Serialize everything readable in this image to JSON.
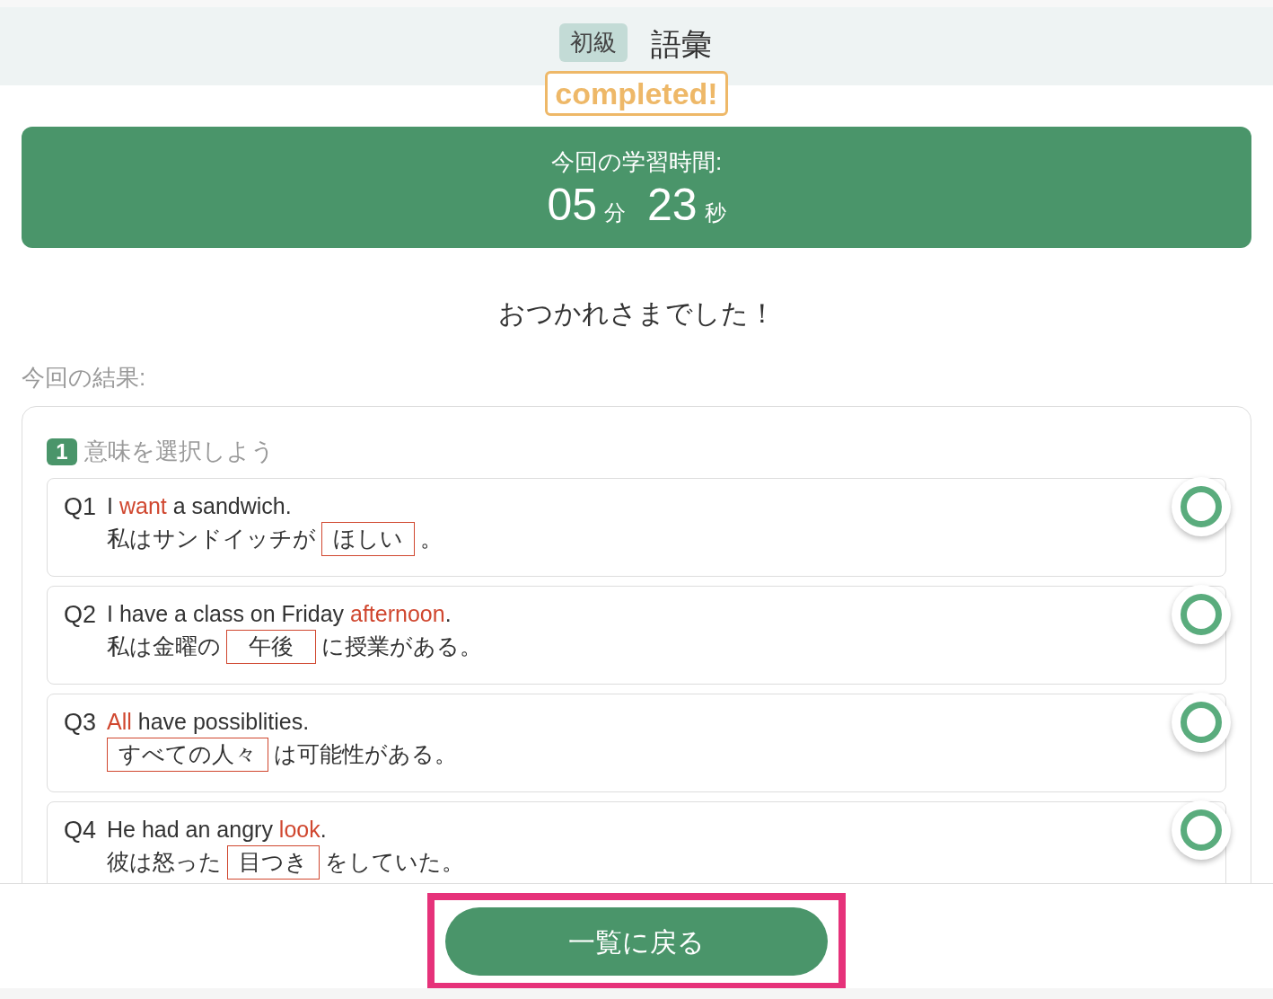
{
  "header": {
    "level_badge": "初級",
    "title": "語彙",
    "status": "completed!"
  },
  "timer": {
    "label": "今回の学習時間:",
    "minutes": "05",
    "minutes_unit": "分",
    "seconds": "23",
    "seconds_unit": "秒"
  },
  "message": "おつかれさまでした！",
  "results_label": "今回の結果:",
  "section": {
    "number": "1",
    "title": "意味を選択しよう"
  },
  "questions": [
    {
      "label": "Q1",
      "english": {
        "before": "I ",
        "keyword": "want",
        "after": " a sandwich."
      },
      "japanese": {
        "before": "私はサンドイッチが",
        "answer": "ほしい",
        "after": "。"
      },
      "correct": true
    },
    {
      "label": "Q2",
      "english": {
        "before": "I have a class on Friday ",
        "keyword": "afternoon",
        "after": "."
      },
      "japanese": {
        "before": "私は金曜の",
        "answer": "午後",
        "after": "に授業がある。"
      },
      "correct": true
    },
    {
      "label": "Q3",
      "english": {
        "keyword": "All",
        "after": " have possiblities."
      },
      "japanese": {
        "answer": "すべての人々",
        "after": "は可能性がある。"
      },
      "correct": true
    },
    {
      "label": "Q4",
      "english": {
        "before": "He had an angry ",
        "keyword": "look",
        "after": "."
      },
      "japanese": {
        "before": "彼は怒った",
        "answer": "目つき",
        "after": "をしていた。"
      },
      "correct": true
    }
  ],
  "back_button": "一覧に戻る"
}
